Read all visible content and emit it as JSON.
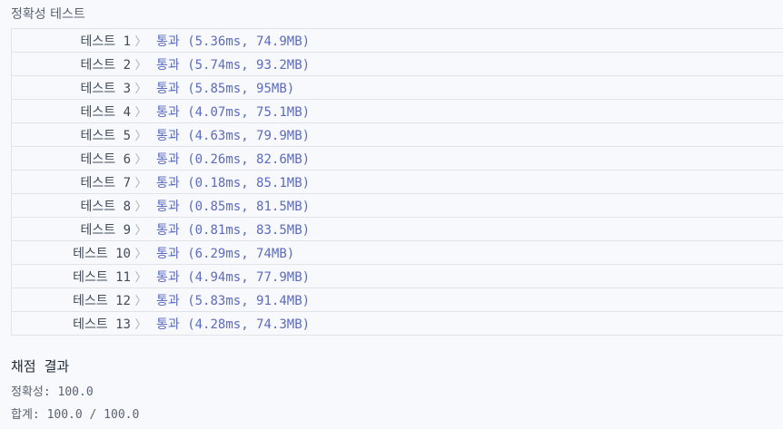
{
  "section": {
    "label": "정확성  테스트"
  },
  "tests": [
    {
      "name": "테스트 1",
      "result": "통과 (5.36ms, 74.9MB)"
    },
    {
      "name": "테스트 2",
      "result": "통과 (5.74ms, 93.2MB)"
    },
    {
      "name": "테스트 3",
      "result": "통과 (5.85ms, 95MB)"
    },
    {
      "name": "테스트 4",
      "result": "통과 (4.07ms, 75.1MB)"
    },
    {
      "name": "테스트 5",
      "result": "통과 (4.63ms, 79.9MB)"
    },
    {
      "name": "테스트 6",
      "result": "통과 (0.26ms, 82.6MB)"
    },
    {
      "name": "테스트 7",
      "result": "통과 (0.18ms, 85.1MB)"
    },
    {
      "name": "테스트 8",
      "result": "통과 (0.85ms, 81.5MB)"
    },
    {
      "name": "테스트 9",
      "result": "통과 (0.81ms, 83.5MB)"
    },
    {
      "name": "테스트 10",
      "result": "통과 (6.29ms, 74MB)"
    },
    {
      "name": "테스트 11",
      "result": "통과 (4.94ms, 77.9MB)"
    },
    {
      "name": "테스트 12",
      "result": "통과 (5.83ms, 91.4MB)"
    },
    {
      "name": "테스트 13",
      "result": "통과 (4.28ms, 74.3MB)"
    }
  ],
  "chevron": "〉",
  "summary": {
    "title": "채점 결과",
    "accuracy": "정확성: 100.0",
    "total": "합계: 100.0 / 100.0"
  },
  "colors": {
    "background": "#f8f9fc",
    "pass_text": "#5c6bc0",
    "border": "#dfe3ea"
  }
}
